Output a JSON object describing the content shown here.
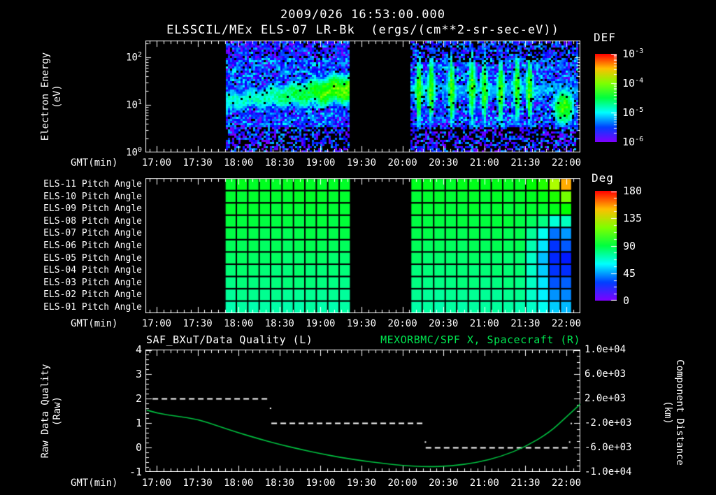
{
  "header": {
    "timestamp": "2009/026 16:53:00.000",
    "instrument_title": "ELSSCIL/MEx ELS-07 LR-Bk  (ergs/(cm**2-sr-sec-eV))"
  },
  "time_axis": {
    "label": "GMT(min)",
    "start_hour": 16.87,
    "end_hour": 22.17,
    "ticks": [
      {
        "hour": 17.0,
        "label": "17:00"
      },
      {
        "hour": 17.5,
        "label": "17:30"
      },
      {
        "hour": 18.0,
        "label": "18:00"
      },
      {
        "hour": 18.5,
        "label": "18:30"
      },
      {
        "hour": 19.0,
        "label": "19:00"
      },
      {
        "hour": 19.5,
        "label": "19:30"
      },
      {
        "hour": 20.0,
        "label": "20:00"
      },
      {
        "hour": 20.5,
        "label": "20:30"
      },
      {
        "hour": 21.0,
        "label": "21:00"
      },
      {
        "hour": 21.5,
        "label": "21:30"
      },
      {
        "hour": 22.0,
        "label": "22:00"
      }
    ]
  },
  "colors": {
    "background": "#000000",
    "text": "#ffffff",
    "green_text": "#00e550",
    "curve_green": "#00c040",
    "rainbow_low_to_high": [
      "#7a00ff",
      "#0040ff",
      "#00c8ff",
      "#00ee44",
      "#aaff00",
      "#ff9000",
      "#ee0000"
    ]
  },
  "chart_data": [
    {
      "id": "electron-energy-spectrogram",
      "type": "heatmap",
      "title": "ELSSCIL/MEx ELS-07 LR-Bk  (ergs/(cm**2-sr-sec-eV))",
      "xlabel": "GMT(min)",
      "ylabel_lines": [
        "Electron Energy",
        "(eV)"
      ],
      "yscale": "log",
      "ylim_eV": [
        1,
        220
      ],
      "ytick_exponents": [
        2,
        1,
        0
      ],
      "colorbar": {
        "title": "DEF",
        "tick_exponents": [
          -3,
          -4,
          -5,
          -6
        ],
        "range_exp": [
          -6,
          -3
        ]
      },
      "data_blocks": [
        {
          "start": "17:50",
          "end": "19:22"
        },
        {
          "start": "20:06",
          "end": "22:09"
        }
      ],
      "features": {
        "background_flux_exp": -5.5,
        "low_energy_speckle_below_eV": 3.5,
        "band": {
          "energy_start_eV": 12,
          "energy_end_eV": 22,
          "flux_exp_start": -4.85,
          "flux_exp_peak": -4.15
        },
        "streak_hours": [
          20.2,
          20.35,
          20.6,
          20.85,
          21.0,
          21.2,
          21.4,
          21.55
        ],
        "blob": {
          "hour": 21.97,
          "energy_eV": 9,
          "flux_exp": -4.2
        }
      }
    },
    {
      "id": "pitch-angle-grid",
      "type": "heatmap",
      "xlabel": "GMT(min)",
      "colorbar": {
        "title": "Deg",
        "ticks": [
          180,
          135,
          90,
          45,
          0
        ],
        "range": [
          0,
          180
        ]
      },
      "data_blocks": [
        {
          "start": "17:50",
          "end": "19:22"
        },
        {
          "start": "20:06",
          "end": "22:04"
        }
      ],
      "column_minutes": 8.3,
      "rows": [
        {
          "label": "ELS-11 Pitch Angle",
          "base_deg": 95,
          "end_deg": [
            105,
            127,
            153
          ]
        },
        {
          "label": "ELS-10 Pitch Angle",
          "base_deg": 93,
          "end_deg": [
            97,
            104,
            118
          ]
        },
        {
          "label": "ELS-09 Pitch Angle",
          "base_deg": 92,
          "end_deg": [
            93,
            96,
            100
          ]
        },
        {
          "label": "ELS-08 Pitch Angle",
          "base_deg": 90,
          "end_deg": [
            80,
            66,
            70
          ]
        },
        {
          "label": "ELS-07 Pitch Angle",
          "base_deg": 88,
          "end_deg": [
            62,
            38,
            44
          ]
        },
        {
          "label": "ELS-06 Pitch Angle",
          "base_deg": 86,
          "end_deg": [
            56,
            28,
            34
          ]
        },
        {
          "label": "ELS-05 Pitch Angle",
          "base_deg": 84,
          "end_deg": [
            50,
            26,
            24
          ]
        },
        {
          "label": "ELS-04 Pitch Angle",
          "base_deg": 82,
          "end_deg": [
            52,
            28,
            27
          ]
        },
        {
          "label": "ELS-03 Pitch Angle",
          "base_deg": 80,
          "end_deg": [
            56,
            33,
            35
          ]
        },
        {
          "label": "ELS-02 Pitch Angle",
          "base_deg": 77,
          "end_deg": [
            58,
            43,
            41
          ]
        },
        {
          "label": "ELS-01 Pitch Angle",
          "base_deg": 74,
          "end_deg": [
            62,
            52,
            49
          ]
        }
      ]
    },
    {
      "id": "quality-and-distance",
      "type": "line",
      "xlabel": "GMT(min)",
      "left_axis": {
        "title": "SAF_BXuT/Data Quality (L)",
        "label_lines": [
          "Raw Data Quality",
          "(Raw)"
        ],
        "ylim": [
          -1,
          4
        ],
        "yticks": [
          4,
          3,
          2,
          1,
          0,
          -1
        ]
      },
      "right_axis": {
        "title": "MEXORBMC/SPF X, Spacecraft (R)",
        "label_lines": [
          "Component Distance",
          "(km)"
        ],
        "ylim": [
          -10000,
          10000
        ],
        "ytick_labels": [
          "1.0e+04",
          "6.0e+03",
          "2.0e+03",
          "-2.0e+03",
          "-6.0e+03",
          "-1.0e+04"
        ],
        "ytick_values": [
          10000,
          6000,
          2000,
          -2000,
          -6000,
          -10000
        ]
      },
      "series": [
        {
          "name": "Data Quality",
          "axis": "left",
          "style": "dashed",
          "color": "#ffffff",
          "segments": [
            {
              "start": "16:57",
              "end": "18:23",
              "value": 2
            },
            {
              "start": "18:24",
              "end": "20:17",
              "value": 1
            },
            {
              "start": "20:17",
              "end": "22:02",
              "value": 0
            }
          ],
          "points": [
            {
              "hour": 18.39,
              "value": 1.6
            },
            {
              "hour": 20.28,
              "value": 0.22
            },
            {
              "hour": 22.06,
              "value": 0.98
            },
            {
              "hour": 22.04,
              "value": 0.22
            }
          ]
        },
        {
          "name": "Spacecraft X",
          "axis": "right",
          "style": "solid",
          "color": "#00c040",
          "points_km": [
            [
              16.88,
              100
            ],
            [
              17.0,
              -400
            ],
            [
              17.25,
              -900
            ],
            [
              17.5,
              -1400
            ],
            [
              17.75,
              -2500
            ],
            [
              18.0,
              -3600
            ],
            [
              18.25,
              -4600
            ],
            [
              18.5,
              -5500
            ],
            [
              18.75,
              -6300
            ],
            [
              19.0,
              -7000
            ],
            [
              19.25,
              -7650
            ],
            [
              19.5,
              -8150
            ],
            [
              19.75,
              -8600
            ],
            [
              20.0,
              -8950
            ],
            [
              20.3,
              -9180
            ],
            [
              20.6,
              -9020
            ],
            [
              20.9,
              -8500
            ],
            [
              21.2,
              -7500
            ],
            [
              21.5,
              -5900
            ],
            [
              21.8,
              -3500
            ],
            [
              22.0,
              -1000
            ],
            [
              22.17,
              1100
            ]
          ]
        }
      ]
    }
  ]
}
